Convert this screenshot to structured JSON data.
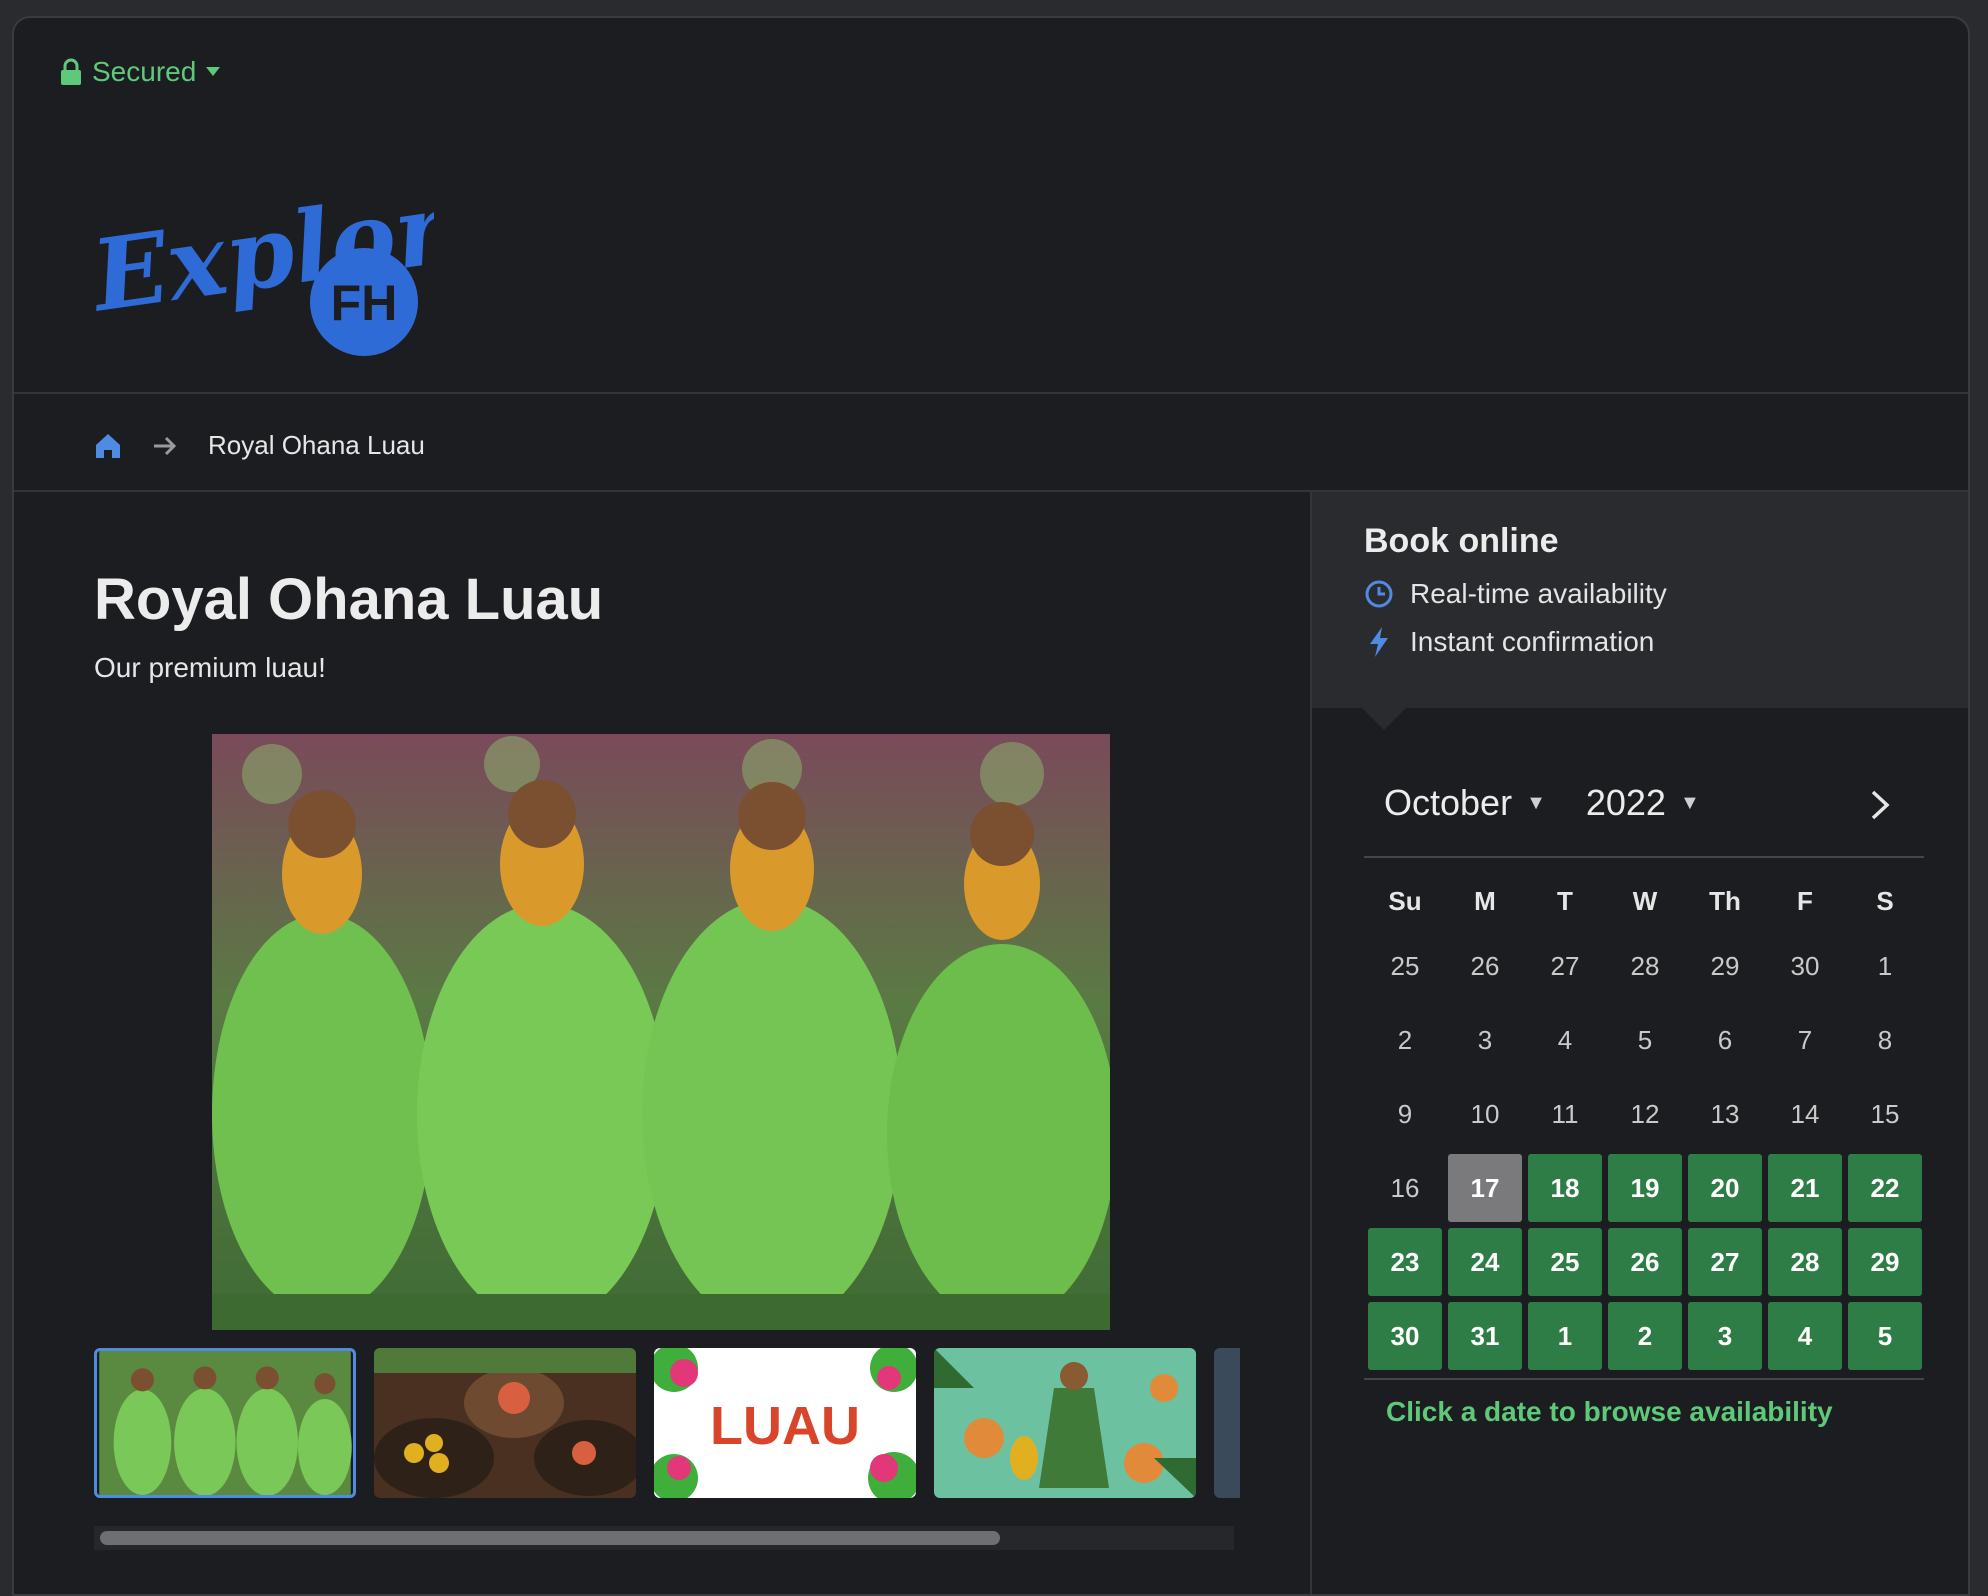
{
  "security": {
    "label": "Secured"
  },
  "logo": {
    "script_text": "Explore",
    "badge_text": "FH",
    "color": "#2f6bd6"
  },
  "breadcrumb": {
    "current": "Royal Ohana Luau"
  },
  "page": {
    "title": "Royal Ohana Luau",
    "subtitle": "Our premium luau!"
  },
  "gallery": {
    "thumbnails": [
      {
        "name": "hula-dancers"
      },
      {
        "name": "luau-food"
      },
      {
        "name": "luau-sign",
        "text": "LUAU"
      },
      {
        "name": "luau-illustration"
      }
    ],
    "selected_index": 0
  },
  "booking": {
    "title": "Book online",
    "features": [
      {
        "icon": "clock-icon",
        "label": "Real-time availability"
      },
      {
        "icon": "lightning-icon",
        "label": "Instant confirmation"
      }
    ]
  },
  "calendar": {
    "month": "October",
    "year": "2022",
    "weekdays": [
      "Su",
      "M",
      "T",
      "W",
      "Th",
      "F",
      "S"
    ],
    "weeks": [
      [
        {
          "d": "25",
          "s": ""
        },
        {
          "d": "26",
          "s": ""
        },
        {
          "d": "27",
          "s": ""
        },
        {
          "d": "28",
          "s": ""
        },
        {
          "d": "29",
          "s": ""
        },
        {
          "d": "30",
          "s": ""
        },
        {
          "d": "1",
          "s": ""
        }
      ],
      [
        {
          "d": "2",
          "s": ""
        },
        {
          "d": "3",
          "s": ""
        },
        {
          "d": "4",
          "s": ""
        },
        {
          "d": "5",
          "s": ""
        },
        {
          "d": "6",
          "s": ""
        },
        {
          "d": "7",
          "s": ""
        },
        {
          "d": "8",
          "s": ""
        }
      ],
      [
        {
          "d": "9",
          "s": ""
        },
        {
          "d": "10",
          "s": ""
        },
        {
          "d": "11",
          "s": ""
        },
        {
          "d": "12",
          "s": ""
        },
        {
          "d": "13",
          "s": ""
        },
        {
          "d": "14",
          "s": ""
        },
        {
          "d": "15",
          "s": ""
        }
      ],
      [
        {
          "d": "16",
          "s": ""
        },
        {
          "d": "17",
          "s": "today"
        },
        {
          "d": "18",
          "s": "avail"
        },
        {
          "d": "19",
          "s": "avail"
        },
        {
          "d": "20",
          "s": "avail"
        },
        {
          "d": "21",
          "s": "avail"
        },
        {
          "d": "22",
          "s": "avail"
        }
      ],
      [
        {
          "d": "23",
          "s": "avail"
        },
        {
          "d": "24",
          "s": "avail"
        },
        {
          "d": "25",
          "s": "avail"
        },
        {
          "d": "26",
          "s": "avail"
        },
        {
          "d": "27",
          "s": "avail"
        },
        {
          "d": "28",
          "s": "avail"
        },
        {
          "d": "29",
          "s": "avail"
        }
      ],
      [
        {
          "d": "30",
          "s": "avail"
        },
        {
          "d": "31",
          "s": "avail"
        },
        {
          "d": "1",
          "s": "avail"
        },
        {
          "d": "2",
          "s": "avail"
        },
        {
          "d": "3",
          "s": "avail"
        },
        {
          "d": "4",
          "s": "avail"
        },
        {
          "d": "5",
          "s": "avail"
        }
      ]
    ],
    "hint": "Click a date to browse availability"
  },
  "colors": {
    "accent_green": "#2f7d46",
    "hint_green": "#5fc97a",
    "blue": "#4f8be0",
    "today_gray": "#7a7a7c"
  }
}
